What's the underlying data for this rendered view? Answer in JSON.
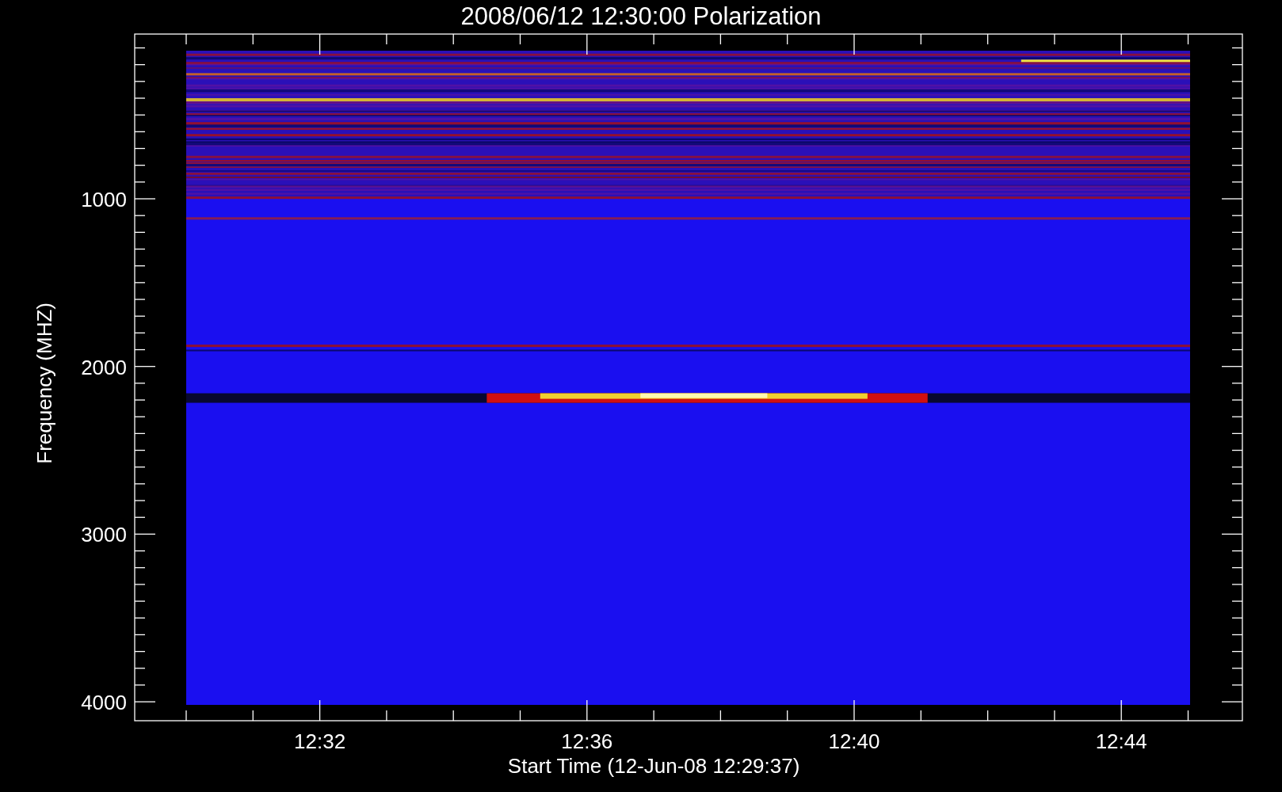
{
  "title": "2008/06/12 12:30:00 Polarization",
  "y_axis": {
    "label": "Frequency (MHZ)",
    "tick_labels": [
      "1000",
      "2000",
      "3000",
      "4000"
    ]
  },
  "x_axis": {
    "label": "Start Time (12-Jun-08 12:29:37)",
    "tick_labels": [
      "12:32",
      "12:36",
      "12:40",
      "12:44"
    ]
  }
}
